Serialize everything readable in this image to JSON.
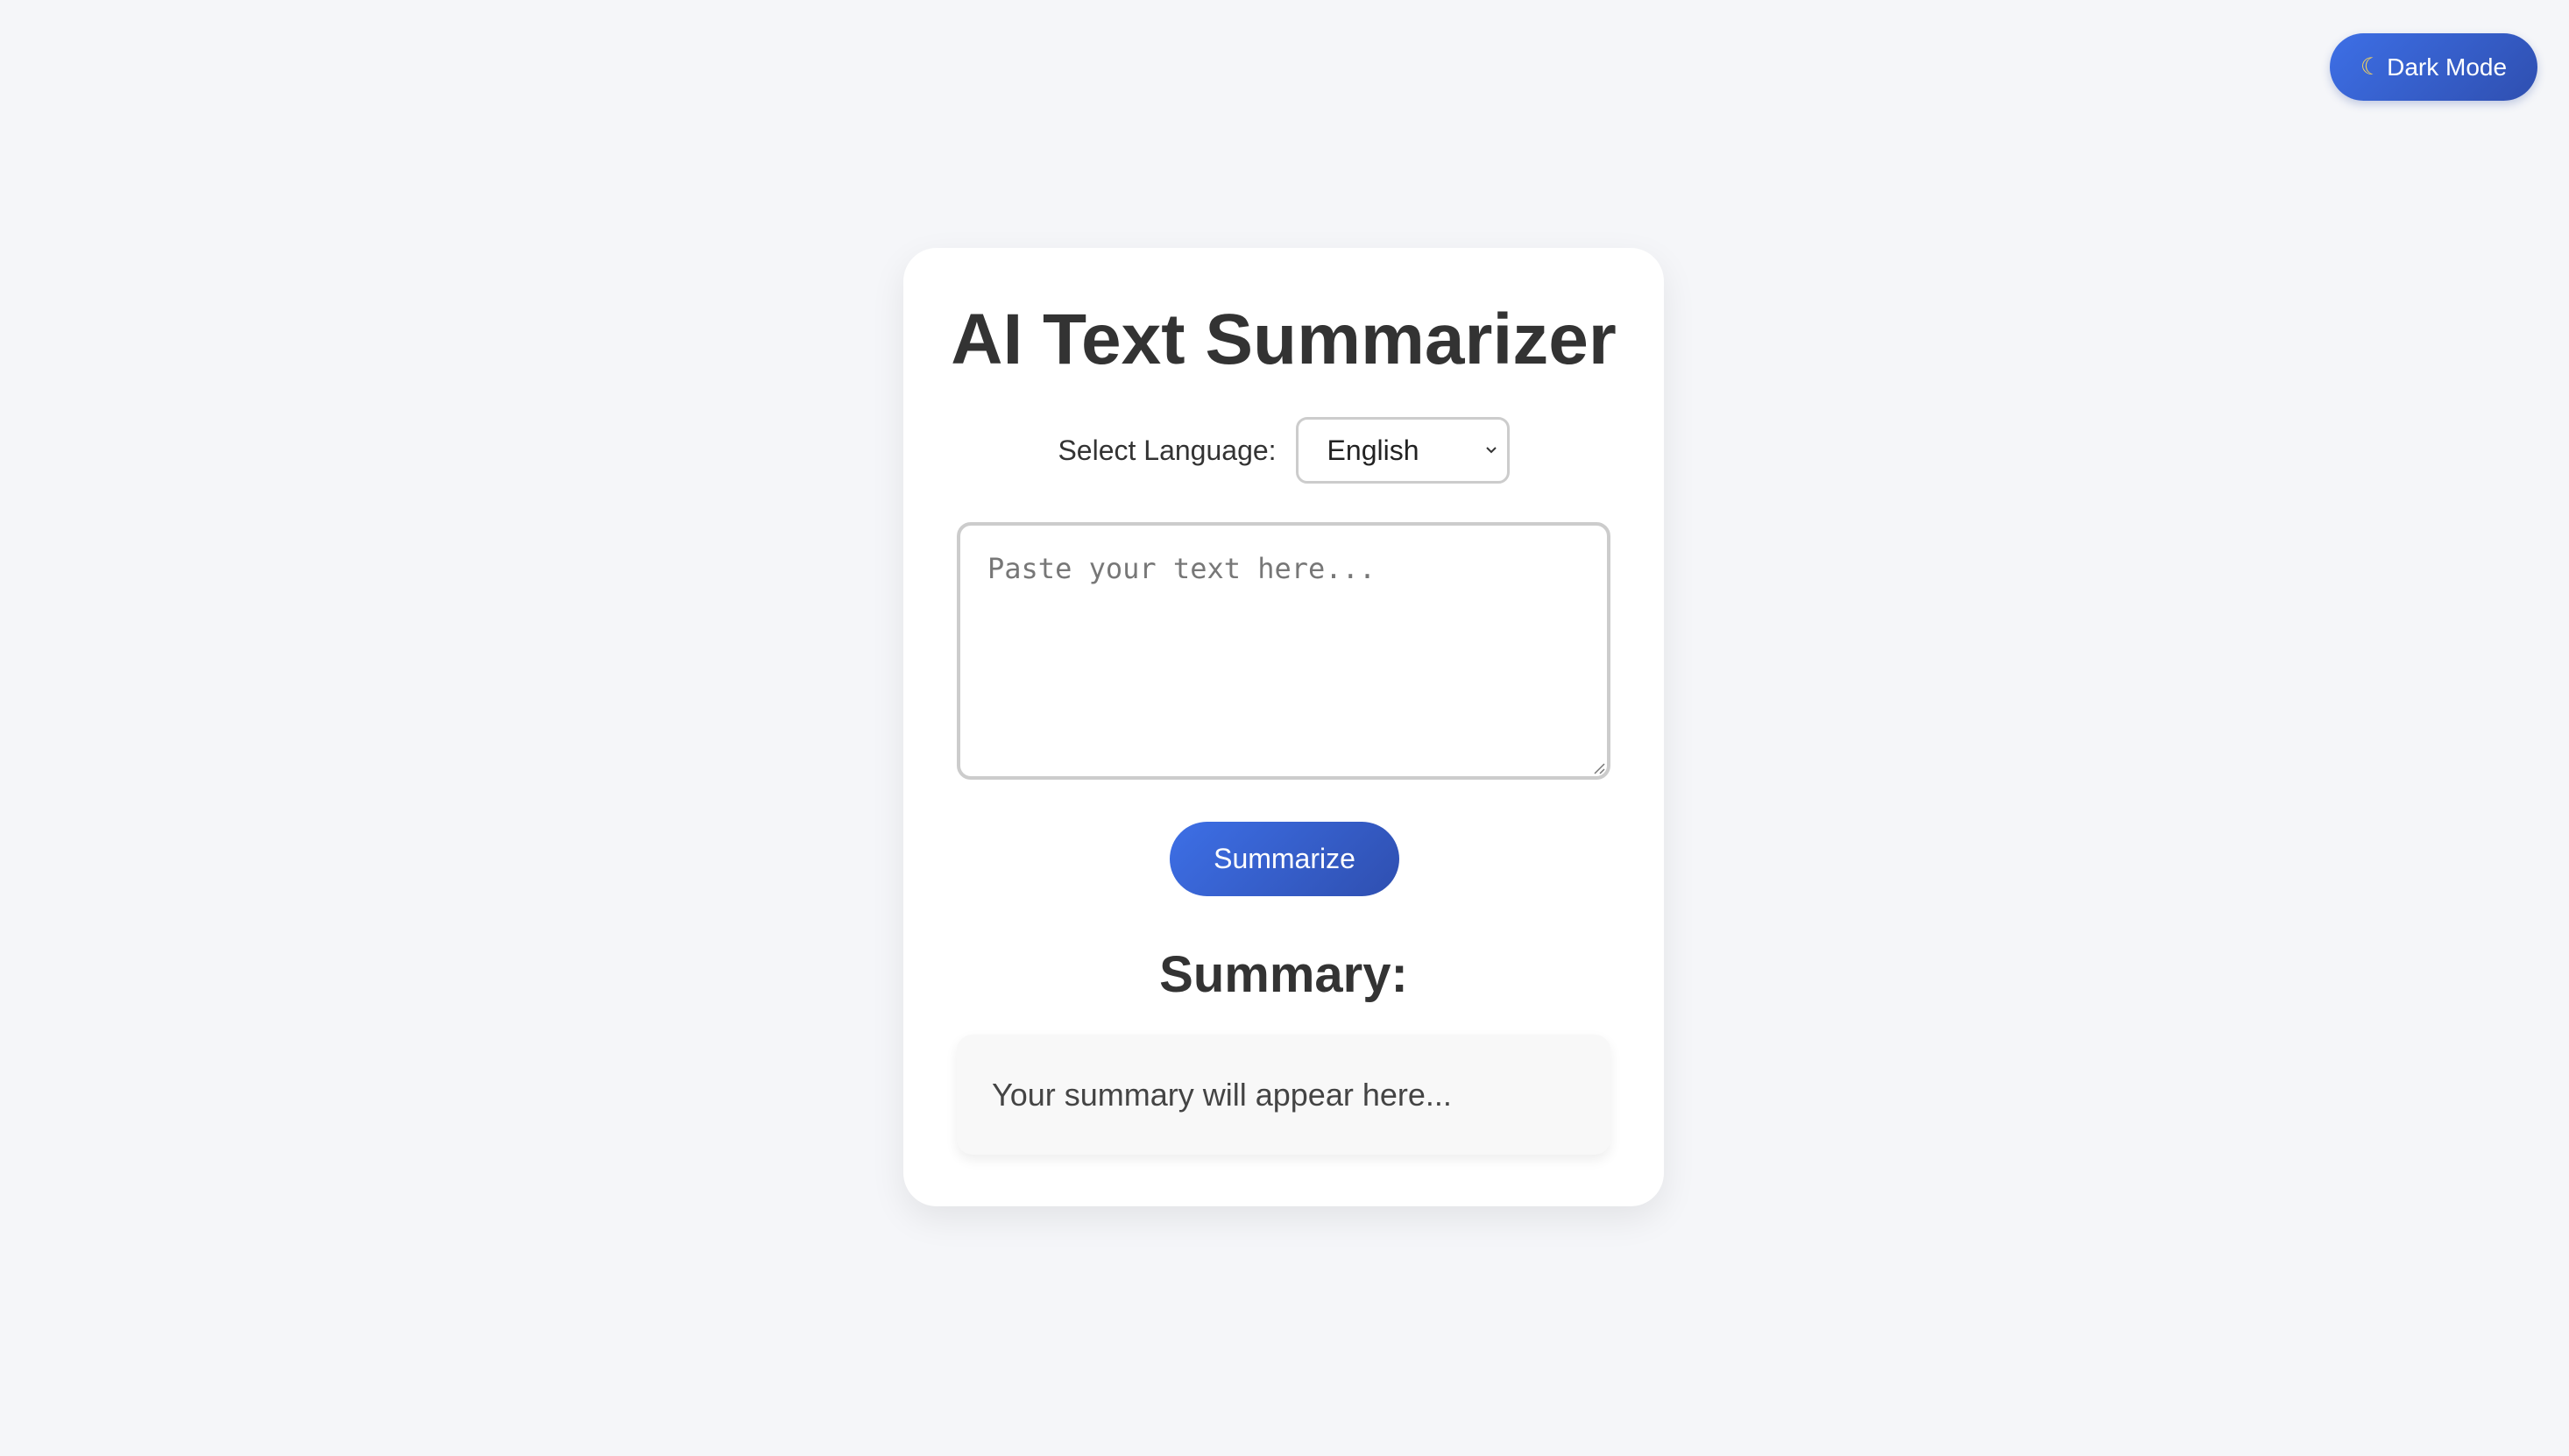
{
  "header": {
    "dark_mode_icon": "moon-icon",
    "dark_mode_label": "Dark Mode"
  },
  "app": {
    "title": "AI Text Summarizer",
    "language": {
      "label": "Select Language:",
      "selected": "English"
    },
    "input": {
      "placeholder": "Paste your text here...",
      "value": ""
    },
    "summarize_label": "Summarize",
    "summary_heading": "Summary:",
    "summary_text": "Your summary will appear here..."
  },
  "colors": {
    "background": "#f5f6f9",
    "accent_start": "#3d6fe6",
    "accent_end": "#2f4fb0",
    "text": "#333333"
  }
}
